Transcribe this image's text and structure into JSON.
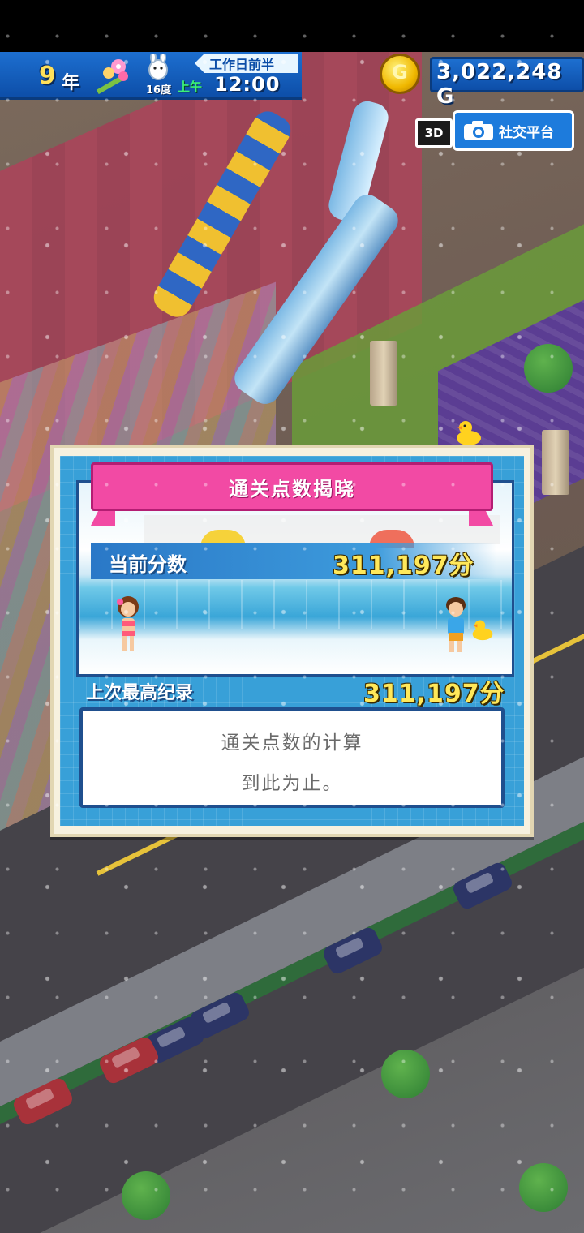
{
  "hud": {
    "year_number": "9",
    "year_unit": "年",
    "temperature": "16度",
    "am_pm": "上午",
    "time": "12:00",
    "period": "工作日前半",
    "gold_value": "3,022,248 G",
    "coin_symbol": "G",
    "badge_3d": "3D",
    "social_label": "社交平台"
  },
  "dialog": {
    "title": "通关点数揭晓",
    "current_score_label": "当前分数",
    "current_score_value": "311,197分",
    "record_label": "上次最高纪录",
    "record_value": "311,197分",
    "message_line1": "通关点数的计算",
    "message_line2": "到此为止。"
  },
  "colors": {
    "hud_blue": "#1d6fd0",
    "banner_pink": "#f24aa4",
    "score_yellow": "#ffe85a",
    "panel_blue": "#38a0d8"
  },
  "icons": [
    "flower-icon",
    "mascot-icon",
    "gold-coin-icon",
    "camera-icon",
    "duck-icon"
  ]
}
